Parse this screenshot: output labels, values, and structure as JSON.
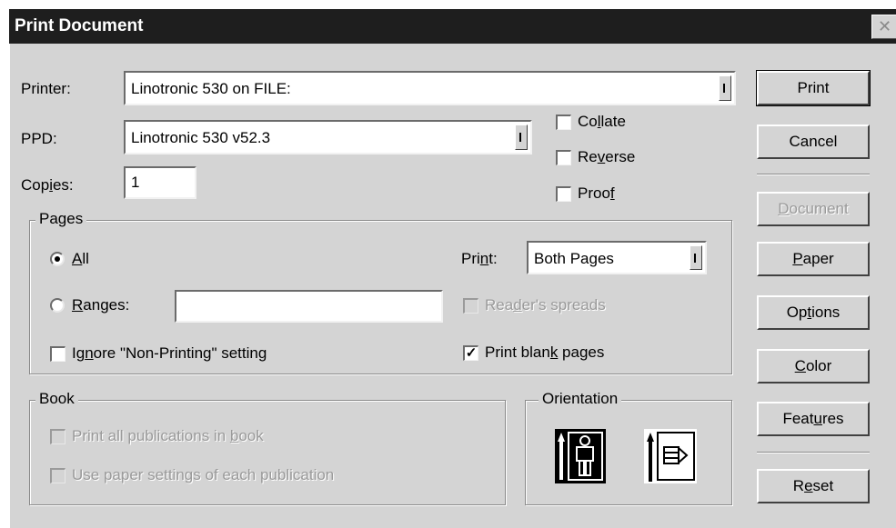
{
  "window": {
    "title": "Print Document",
    "close_glyph": "✕"
  },
  "fields": {
    "printer_label": "Printer:",
    "printer_value": "Linotronic 530 on FILE:",
    "ppd_label": "PPD:",
    "ppd_value": "Linotronic 530 v52.3",
    "copies_label_pre": "Cop",
    "copies_label_ul": "i",
    "copies_label_post": "es:",
    "copies_value": "1"
  },
  "options": {
    "collate": {
      "pre": "Co",
      "ul": "l",
      "post": "late",
      "checked": false
    },
    "reverse": {
      "pre": "Re",
      "ul": "v",
      "post": "erse",
      "checked": false
    },
    "proof": {
      "pre": "Proo",
      "ul": "f",
      "post": "",
      "checked": false
    }
  },
  "pages": {
    "group_title": "Pages",
    "all": {
      "pre": "",
      "ul": "A",
      "post": "ll",
      "selected": true
    },
    "ranges": {
      "pre": "",
      "ul": "R",
      "post": "anges:",
      "selected": false,
      "value": ""
    },
    "ignore": {
      "pre": "Ig",
      "ul": "n",
      "post": "ore \"Non-Printing\" setting",
      "checked": false
    },
    "print_label": {
      "pre": "Pri",
      "ul": "n",
      "post": "t:"
    },
    "print_value": "Both Pages",
    "readers": {
      "pre": "Rea",
      "ul": "d",
      "post": "er's spreads",
      "checked": false,
      "disabled": true
    },
    "blank": {
      "pre": "Print blan",
      "ul": "k",
      "post": " pages",
      "checked": true
    }
  },
  "book": {
    "group_title": "Book",
    "all_pubs": {
      "pre": "Print all publications in ",
      "ul": "b",
      "post": "ook",
      "disabled": true
    },
    "paper_settings": {
      "pre": "Use paper settin",
      "ul": "g",
      "post": "s of each publication",
      "disabled": true
    }
  },
  "orientation": {
    "group_title": "Orientation",
    "portrait_icon": "portrait-orientation-icon",
    "landscape_icon": "landscape-orientation-icon",
    "selected": "portrait"
  },
  "buttons": {
    "print": {
      "pre": "Print",
      "ul": "",
      "post": ""
    },
    "cancel": {
      "pre": "Cancel",
      "ul": "",
      "post": ""
    },
    "document": {
      "pre": "",
      "ul": "D",
      "post": "ocument",
      "disabled": true
    },
    "paper": {
      "pre": "",
      "ul": "P",
      "post": "aper"
    },
    "options": {
      "pre": "Op",
      "ul": "t",
      "post": "ions"
    },
    "color": {
      "pre": "",
      "ul": "C",
      "post": "olor"
    },
    "features": {
      "pre": "Feat",
      "ul": "u",
      "post": "res"
    },
    "reset": {
      "pre": "R",
      "ul": "e",
      "post": "set"
    }
  },
  "check_glyph": "✓"
}
